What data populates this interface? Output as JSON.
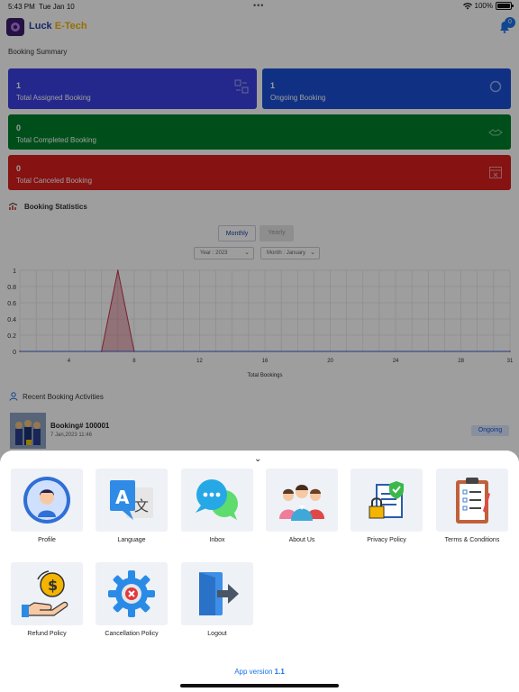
{
  "status_bar": {
    "time": "5:43 PM",
    "date": "Tue Jan 10",
    "battery": "100%"
  },
  "header": {
    "brand_part1": "Luck",
    "brand_part2": "E-Tech",
    "notification_count": "0"
  },
  "booking_summary": {
    "title": "Booking Summary",
    "cards": [
      {
        "value": "1",
        "label": "Total Assigned Booking",
        "color": "#3b3fe0"
      },
      {
        "value": "1",
        "label": "Ongoing Booking",
        "color": "#1b4fd4"
      },
      {
        "value": "0",
        "label": "Total Completed Booking",
        "color": "#00802b"
      },
      {
        "value": "0",
        "label": "Total Canceled Booking",
        "color": "#d81e1e"
      }
    ]
  },
  "statistics": {
    "title": "Booking Statistics",
    "tabs": [
      "Monthly",
      "Yearly"
    ],
    "year_label": "Year",
    "year_value": "2023",
    "month_label": "Month",
    "month_value": "January"
  },
  "chart_data": {
    "type": "area",
    "title": "",
    "xlabel": "Total Bookings",
    "ylabel": "",
    "x_ticks": [
      4,
      8,
      12,
      16,
      20,
      24,
      28,
      31
    ],
    "y_ticks": [
      0,
      0.2,
      0.4,
      0.6,
      0.8,
      1
    ],
    "xlim": [
      1,
      31
    ],
    "ylim": [
      0,
      1
    ],
    "series": [
      {
        "color": "#c0334a",
        "x": [
          1,
          6,
          7,
          8,
          31
        ],
        "values": [
          0,
          0,
          1,
          0,
          0
        ]
      }
    ],
    "grid": true
  },
  "activity": {
    "title": "Recent Booking Activities",
    "items": [
      {
        "booking": "Booking# 100001",
        "date": "7 Jan,2023 11:46",
        "status": "Ongoing"
      }
    ]
  },
  "menu": {
    "items": [
      {
        "label": "Profile",
        "icon": "profile-icon"
      },
      {
        "label": "Language",
        "icon": "language-icon"
      },
      {
        "label": "Inbox",
        "icon": "inbox-icon"
      },
      {
        "label": "About Us",
        "icon": "about-us-icon"
      },
      {
        "label": "Privacy Policy",
        "icon": "privacy-policy-icon"
      },
      {
        "label": "Terms & Conditions",
        "icon": "terms-icon"
      },
      {
        "label": "Refund Policy",
        "icon": "refund-policy-icon"
      },
      {
        "label": "Cancellation Policy",
        "icon": "cancellation-policy-icon"
      },
      {
        "label": "Logout",
        "icon": "logout-icon"
      }
    ],
    "version_label": "App version",
    "version_number": "1.1"
  }
}
